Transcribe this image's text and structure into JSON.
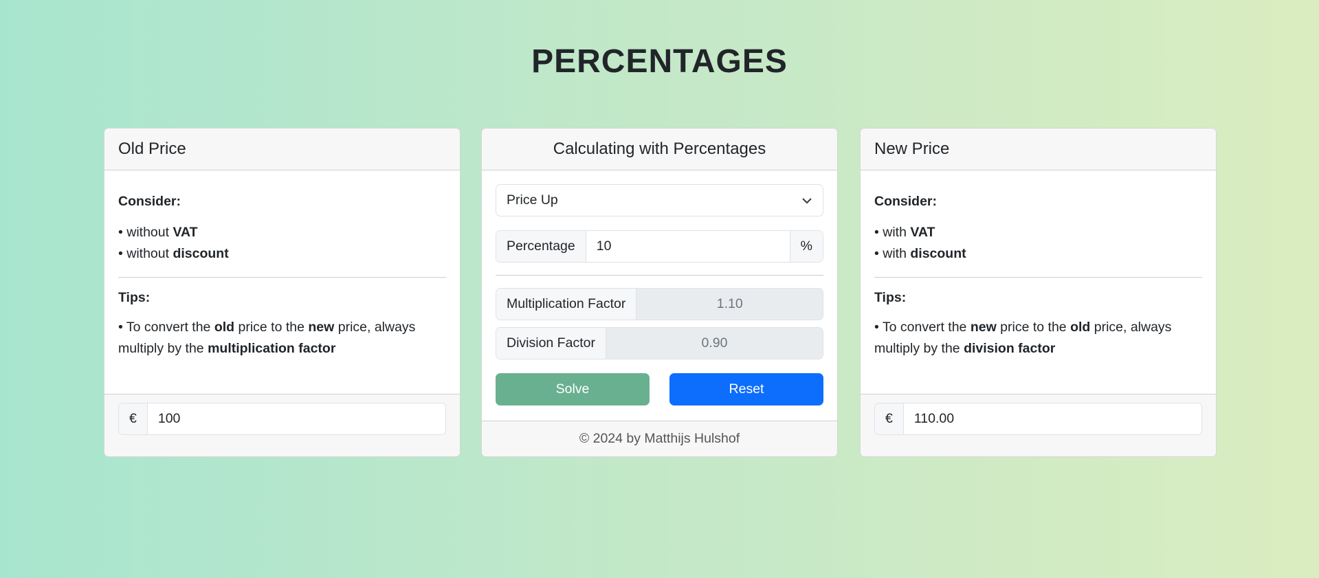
{
  "title": "PERCENTAGES",
  "old": {
    "header": "Old Price",
    "consider": "Consider:",
    "items": [
      [
        "without ",
        "VAT"
      ],
      [
        "without ",
        "discount"
      ]
    ],
    "tips": "Tips:",
    "tip": {
      "a": "To convert the ",
      "b": "old",
      "c": " price to the ",
      "d": "new",
      "e": " price, always multiply by the ",
      "f": "multiplication factor"
    },
    "currency": "€",
    "value": "100"
  },
  "calc": {
    "header": "Calculating with Percentages",
    "mode": "Price Up",
    "pct_label": "Percentage",
    "pct_value": "10",
    "pct_unit": "%",
    "mult_label": "Multiplication Factor",
    "mult_value": "1.10",
    "div_label": "Division Factor",
    "div_value": "0.90",
    "solve": "Solve",
    "reset": "Reset",
    "footer": "© 2024 by Matthijs Hulshof",
    "solve_color": "#69b091",
    "reset_color": "#0d6efd"
  },
  "new": {
    "header": "New Price",
    "consider": "Consider:",
    "items": [
      [
        "with ",
        "VAT"
      ],
      [
        "with ",
        "discount"
      ]
    ],
    "tips": "Tips:",
    "tip": {
      "a": "To convert the ",
      "b": "new",
      "c": " price to the ",
      "d": "old",
      "e": " price, always multiply by the ",
      "f": "division factor"
    },
    "currency": "€",
    "value": "110.00"
  }
}
